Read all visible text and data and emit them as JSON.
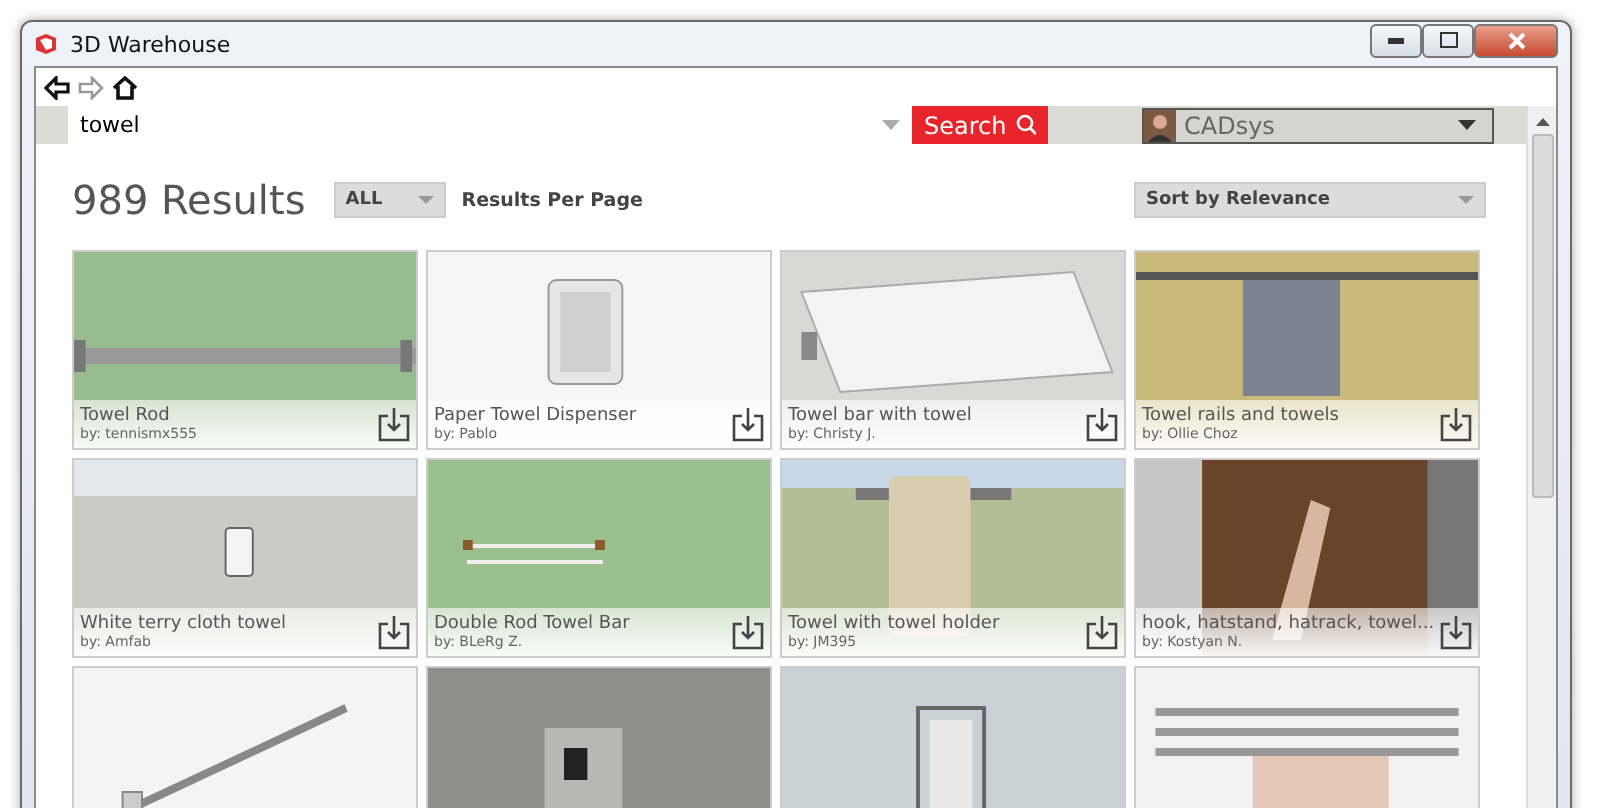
{
  "window": {
    "title": "3D Warehouse"
  },
  "search": {
    "value": "towel",
    "button": "Search"
  },
  "account": {
    "name": "CADsys"
  },
  "results": {
    "count": "989 Results",
    "per_page": "ALL",
    "per_page_label": "Results Per Page",
    "sort": "Sort by Relevance"
  },
  "items": [
    {
      "kind": "model",
      "title": "Towel Rod",
      "author": "by: tennismx555"
    },
    {
      "kind": "model",
      "title": "Paper Towel Dispenser",
      "author": "by: Pablo"
    },
    {
      "kind": "model",
      "title": "Towel bar with towel",
      "author": "by: Christy J."
    },
    {
      "kind": "model",
      "title": "Towel rails and towels",
      "author": "by: Ollie Choz"
    },
    {
      "kind": "model",
      "title": "White terry cloth towel",
      "author": "by: Amfab"
    },
    {
      "kind": "model",
      "title": "Double Rod Towel Bar",
      "author": "by: BLeRg Z."
    },
    {
      "kind": "model",
      "title": "Towel with towel holder",
      "author": "by: JM395"
    },
    {
      "kind": "model",
      "title": "hook, hatstand, hatrack, towel...",
      "author": "by: Kostyan N."
    },
    {
      "kind": "picture"
    },
    {
      "kind": "picture"
    },
    {
      "kind": "picture"
    },
    {
      "kind": "picture"
    }
  ]
}
